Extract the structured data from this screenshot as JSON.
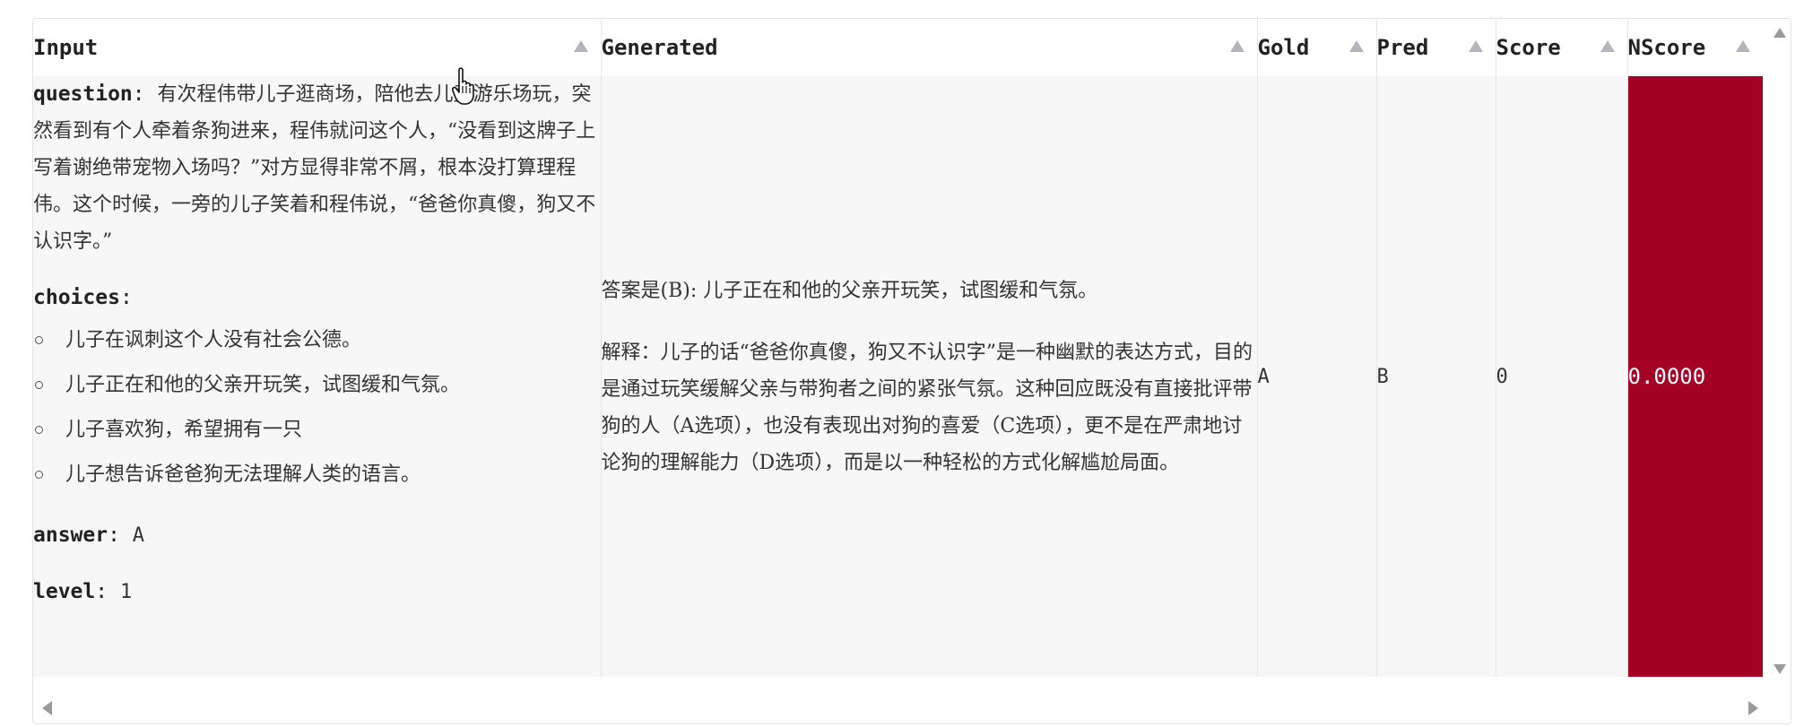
{
  "table": {
    "columns": [
      {
        "key": "input",
        "label": "Input"
      },
      {
        "key": "generated",
        "label": "Generated"
      },
      {
        "key": "gold",
        "label": "Gold"
      },
      {
        "key": "pred",
        "label": "Pred"
      },
      {
        "key": "score",
        "label": "Score"
      },
      {
        "key": "nscore",
        "label": "NScore"
      }
    ],
    "row": {
      "input": {
        "question_key": "question",
        "question": "有次程伟带儿子逛商场，陪他去儿童游乐场玩，突然看到有个人牵着条狗进来，程伟就问这个人，“没看到这牌子上写着谢绝带宠物入场吗？”对方显得非常不屑，根本没打算理程伟。这个时候，一旁的儿子笑着和程伟说，“爸爸你真傻，狗又不认识字。”",
        "choices_key": "choices",
        "choices": [
          "儿子在讽刺这个人没有社会公德。",
          "儿子正在和他的父亲开玩笑，试图缓和气氛。",
          "儿子喜欢狗，希望拥有一只",
          "儿子想告诉爸爸狗无法理解人类的语言。"
        ],
        "answer_key": "answer",
        "answer": "A",
        "level_key": "level",
        "level": "1"
      },
      "generated": {
        "line1": "答案是(B): 儿子正在和他的父亲开玩笑，试图缓和气氛。",
        "line2": "解释：儿子的话“爸爸你真傻，狗又不认识字”是一种幽默的表达方式，目的是通过玩笑缓解父亲与带狗者之间的紧张气氛。这种回应既没有直接批评带狗的人（A选项），也没有表现出对狗的喜爱（C选项），更不是在严肃地讨论狗的理解能力（D选项），而是以一种轻松的方式化解尴尬局面。"
      },
      "gold": "A",
      "pred": "B",
      "score": "0",
      "nscore": "0.0000"
    }
  },
  "colors": {
    "nscore_bg": "#a50026",
    "cell_bg": "#f7f7f7",
    "sort_icon": "#b4b4bc"
  },
  "icons": {
    "sort": "sort-up-icon",
    "cursor": "hand-pointer-icon",
    "scroll_up": "scroll-up-arrow-icon",
    "scroll_down": "scroll-down-arrow-icon",
    "scroll_left": "scroll-left-arrow-icon",
    "scroll_right": "scroll-right-arrow-icon"
  }
}
